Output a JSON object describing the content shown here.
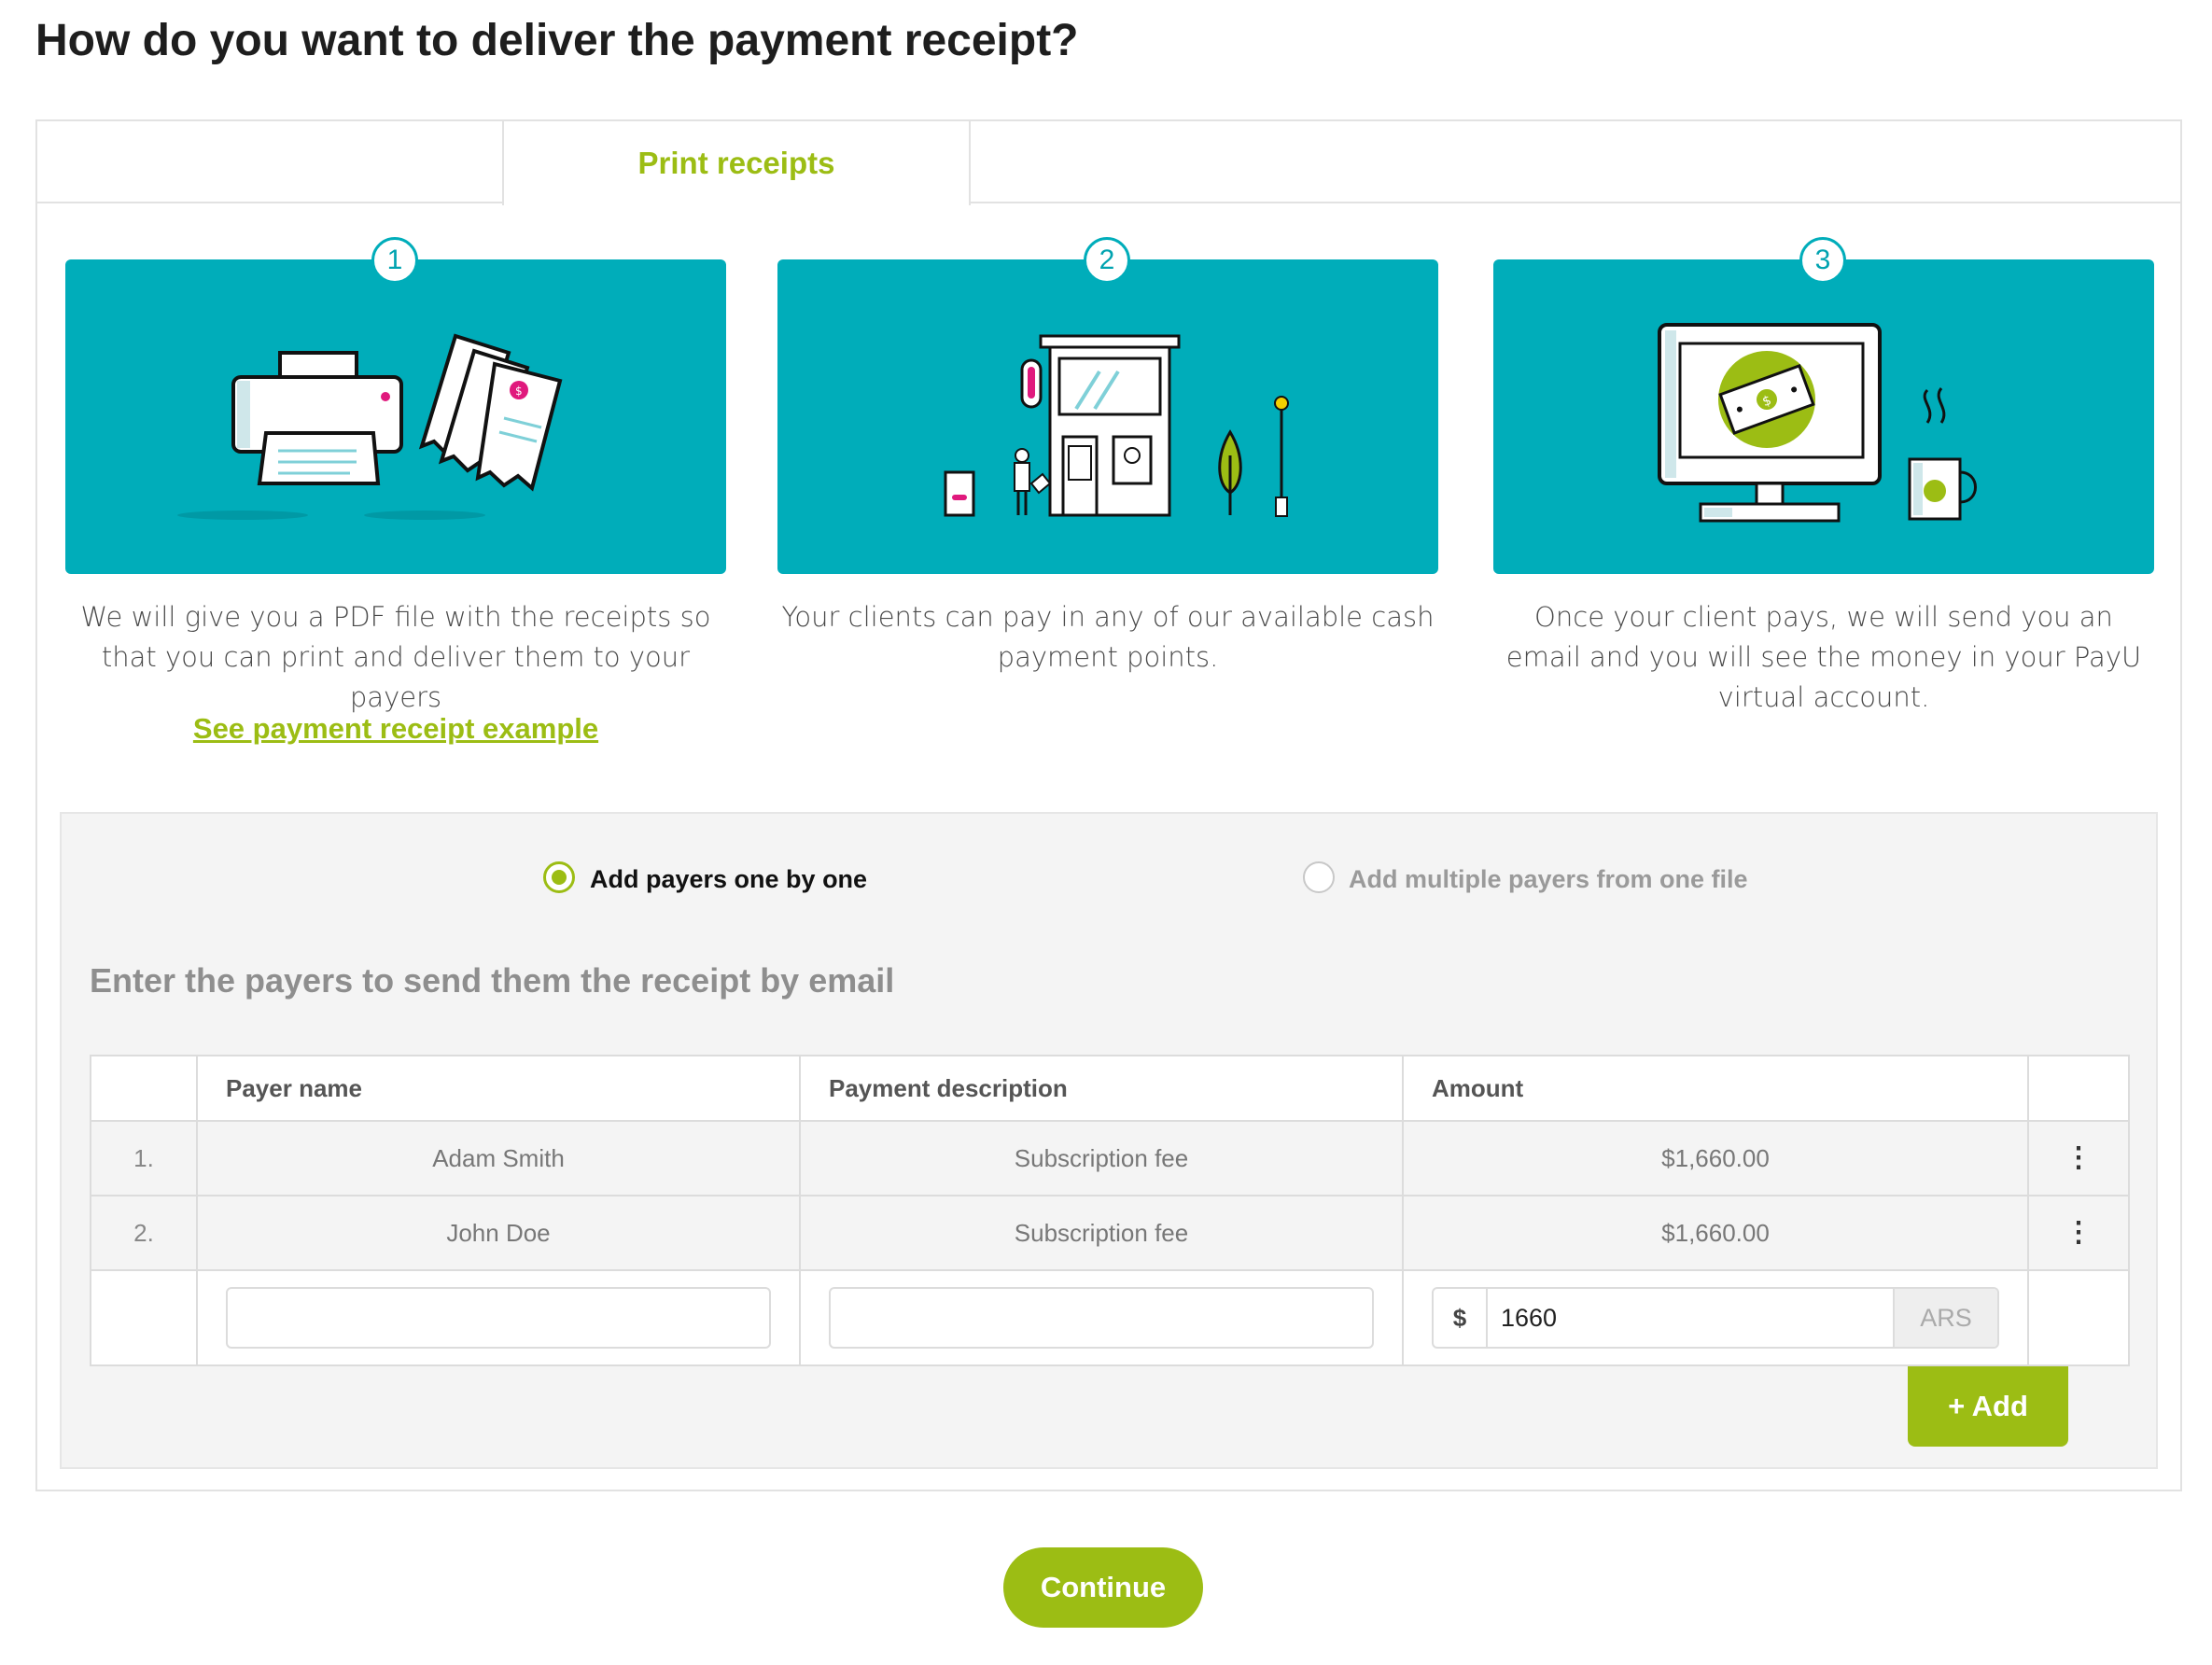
{
  "page": {
    "title": "How do you want to deliver the payment receipt?"
  },
  "tabs": {
    "active_label": "Print receipts"
  },
  "steps": [
    {
      "number": "1",
      "description": "We will give you a PDF file with the receipts so that you can print and deliver them to your payers",
      "illustration": "printer-receipts-icon"
    },
    {
      "number": "2",
      "description": "Your clients can pay in any of our available cash payment points.",
      "illustration": "cash-payment-point-icon"
    },
    {
      "number": "3",
      "description": "Once your client pays, we will send you an email and you will see the money in your PayU virtual account.",
      "illustration": "monitor-money-icon"
    }
  ],
  "example_link": "See payment receipt example",
  "mode": {
    "one_by_one_label": "Add payers one by one",
    "multiple_label": "Add multiple payers from one file",
    "selected": "one_by_one"
  },
  "section_heading": "Enter the payers to send them the receipt by email",
  "table": {
    "headers": {
      "payer_name": "Payer name",
      "payment_description": "Payment description",
      "amount": "Amount"
    },
    "rows": [
      {
        "index": "1.",
        "payer_name": "Adam Smith",
        "description": "Subscription fee",
        "amount": "$1,660.00"
      },
      {
        "index": "2.",
        "payer_name": "John Doe",
        "description": "Subscription fee",
        "amount": "$1,660.00"
      }
    ],
    "new_row": {
      "payer_name": "",
      "description": "",
      "currency_symbol": "$",
      "amount_value": "1660",
      "currency_code": "ARS"
    }
  },
  "buttons": {
    "add": "+ Add",
    "continue": "Continue"
  },
  "colors": {
    "accent_green": "#9cbd14",
    "teal": "#00adba",
    "magenta": "#e0197d"
  }
}
